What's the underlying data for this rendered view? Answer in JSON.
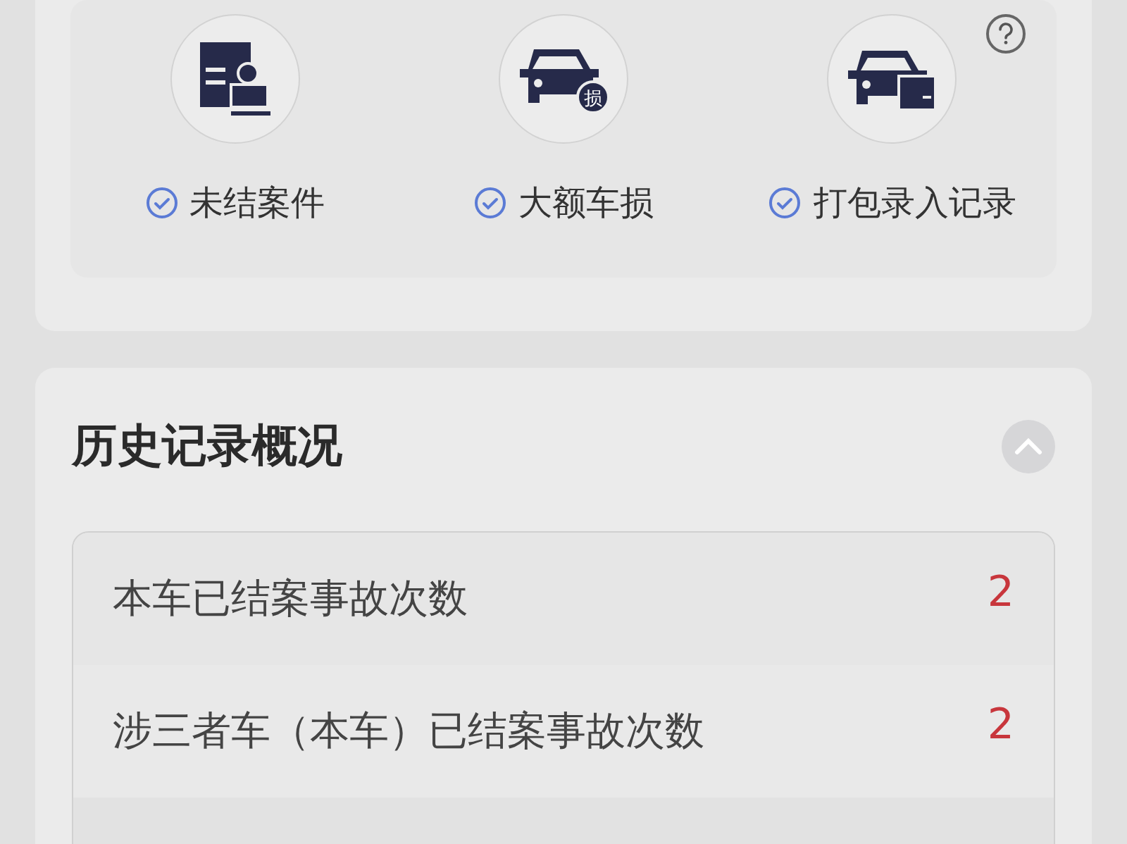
{
  "features": [
    {
      "kind": "stamp",
      "label": "未结案件",
      "checked": true
    },
    {
      "kind": "damage",
      "label": "大额车损",
      "checked": true,
      "badge": "损"
    },
    {
      "kind": "package",
      "label": "打包录入记录",
      "checked": true
    }
  ],
  "history": {
    "title": "历史记录概况",
    "expanded": true,
    "rows": [
      {
        "label": "本车已结案事故次数",
        "value": "2"
      },
      {
        "label": "涉三者车（本车）已结案事故次数",
        "value": "2"
      }
    ]
  }
}
